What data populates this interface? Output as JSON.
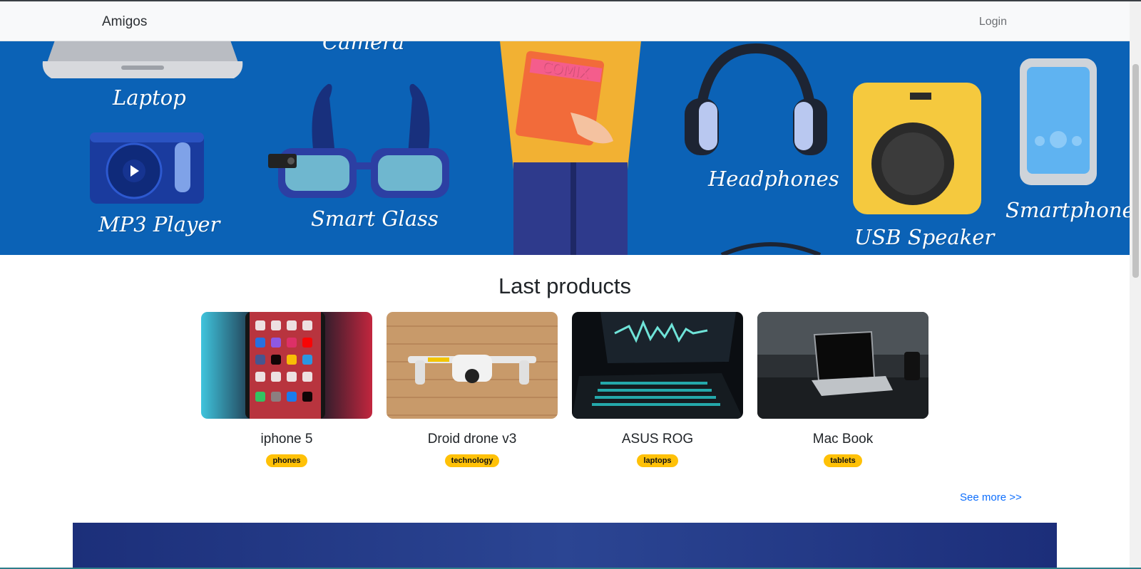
{
  "navbar": {
    "brand": "Amigos",
    "login_label": "Login"
  },
  "hero": {
    "labels": {
      "laptop": "Laptop",
      "camera": "Camera",
      "mp3": "MP3 Player",
      "smart_glass": "Smart Glass",
      "headphones": "Headphones",
      "usb_speaker": "USB Speaker",
      "smartphone": "Smartphone",
      "comix": "COMIX"
    },
    "colors": {
      "background": "#0b62b6"
    }
  },
  "section": {
    "title": "Last products"
  },
  "products": [
    {
      "name": "iphone 5",
      "category": "phones",
      "image_icon": "smartphone-photo"
    },
    {
      "name": "Droid drone v3",
      "category": "technology",
      "image_icon": "drone-photo"
    },
    {
      "name": "ASUS ROG",
      "category": "laptops",
      "image_icon": "gaming-laptop-photo"
    },
    {
      "name": "Mac Book",
      "category": "tablets",
      "image_icon": "laptop-photo"
    }
  ],
  "see_more_label": "See more >>",
  "colors": {
    "badge": "#ffc107",
    "link": "#0d6efd",
    "banner": "#2b4593"
  }
}
